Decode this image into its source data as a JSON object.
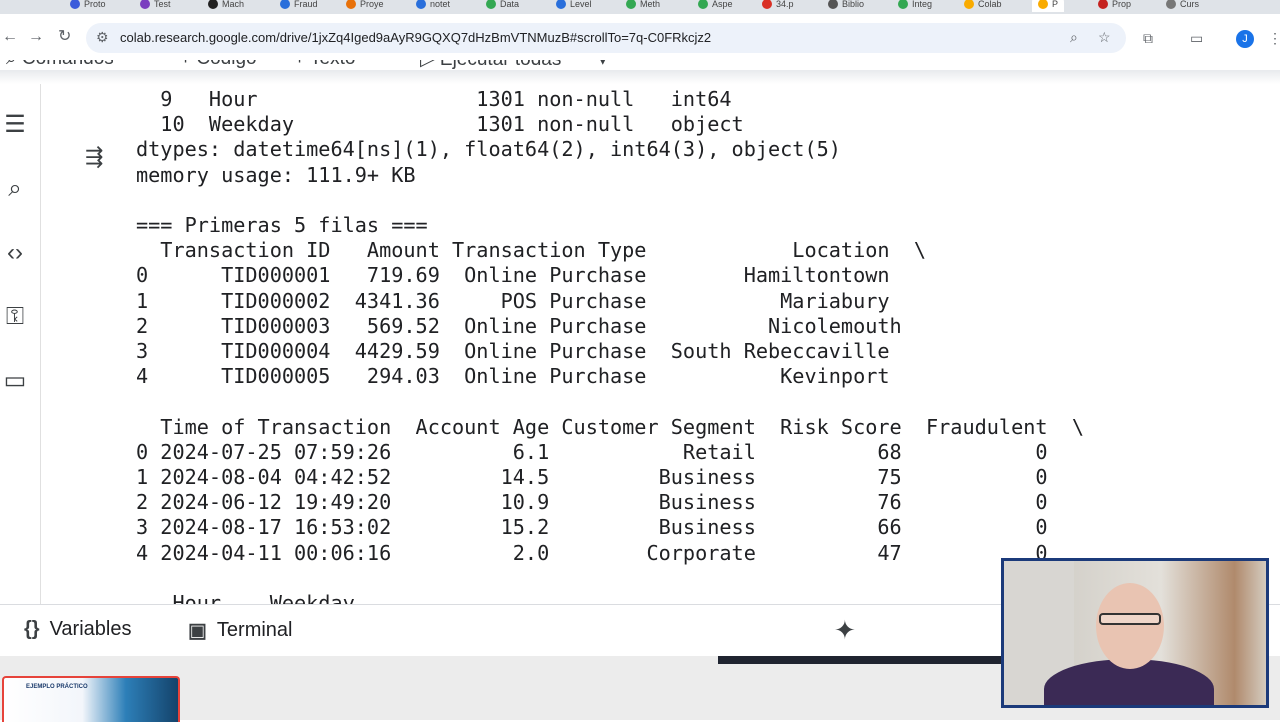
{
  "browser": {
    "tabs": [
      "Proto",
      "Test",
      "Mach",
      "Fraud",
      "Proye",
      "notet",
      "Data",
      "Level",
      "Meth",
      "Aspe",
      "34.p",
      "Biblio",
      "Integ",
      "Colab",
      "P",
      "Prop",
      "Curs"
    ],
    "url": "colab.research.google.com/drive/1jxZq4Iged9aAyR9GQXQ7dHzBmVTNMuzB#scrollTo=7q-C0FRkcjz2",
    "profile_initial": "J"
  },
  "toolbar": {
    "commands": "Comandos",
    "code": "+ Código",
    "text": "+ Texto",
    "run_all": "▷ Ejecutar todas"
  },
  "output": {
    "lines": [
      "  9   Hour                  1301 non-null   int64",
      "  10  Weekday               1301 non-null   object",
      "dtypes: datetime64[ns](1), float64(2), int64(3), object(5)",
      "memory usage: 111.9+ KB",
      "",
      "=== Primeras 5 filas ===",
      "  Transaction ID   Amount Transaction Type            Location  \\",
      "0      TID000001   719.69  Online Purchase        Hamiltontown",
      "1      TID000002  4341.36     POS Purchase           Mariabury",
      "2      TID000003   569.52  Online Purchase          Nicolemouth",
      "3      TID000004  4429.59  Online Purchase  South Rebeccaville",
      "4      TID000005   294.03  Online Purchase           Kevinport",
      "",
      "  Time of Transaction  Account Age Customer Segment  Risk Score  Fraudulent  \\",
      "0 2024-07-25 07:59:26          6.1           Retail          68           0",
      "1 2024-08-04 04:42:52         14.5         Business          75           0",
      "2 2024-06-12 19:49:20         10.9         Business          76           0",
      "3 2024-08-17 16:53:02         15.2         Business          66           0",
      "4 2024-04-11 00:06:16          2.0        Corporate          47           0",
      "",
      "   Hour    Weekday"
    ]
  },
  "bottombar": {
    "variables": "Variables",
    "terminal": "Terminal"
  },
  "taskbar": {
    "thumbnail_title": "EJEMPLO PRÁCTICO"
  }
}
